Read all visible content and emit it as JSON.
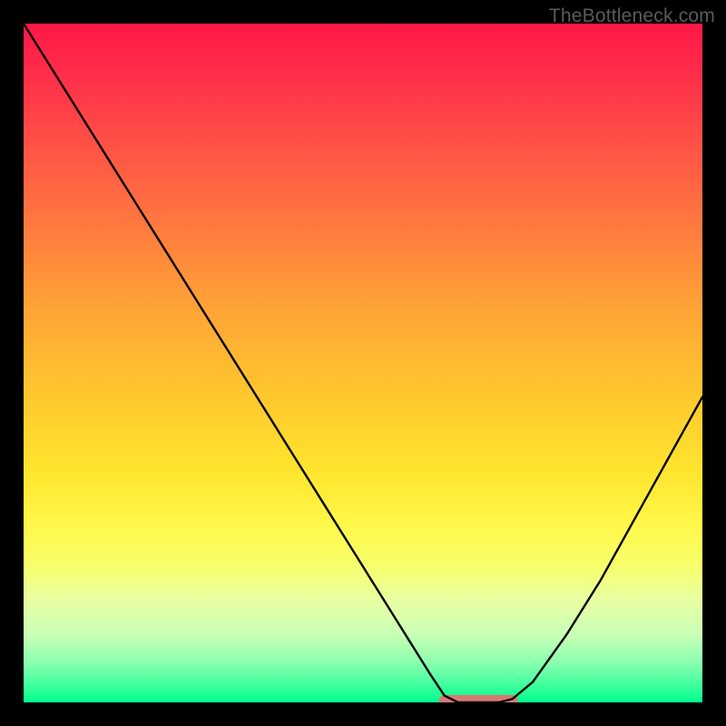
{
  "watermark": "TheBottleneck.com",
  "colors": {
    "frame": "#000000",
    "curve": "#000000",
    "highlight": "#d77a74"
  },
  "chart_data": {
    "type": "line",
    "title": "",
    "xlabel": "",
    "ylabel": "",
    "xlim": [
      0,
      100
    ],
    "ylim": [
      0,
      100
    ],
    "x": [
      0,
      5,
      10,
      15,
      20,
      25,
      30,
      35,
      40,
      45,
      50,
      55,
      60,
      62,
      64,
      66,
      68,
      70,
      72,
      75,
      80,
      85,
      90,
      95,
      100
    ],
    "y": [
      100,
      92,
      84,
      76,
      68,
      60,
      52,
      44,
      36,
      28,
      20,
      12,
      4,
      1,
      0,
      0,
      0,
      0,
      0.5,
      3,
      10,
      18,
      27,
      36,
      45
    ],
    "flat_region_x": [
      62,
      72
    ],
    "notes": "V-shaped bottleneck curve. Left arm descends nearly linearly from (0,100) to about (62,1). Bottom is flat at y≈0 between x≈62 and x≈72 — highlighted in a salmon/pink color. Right arm rises from (72,0.5) to roughly (100,45). Background is a vertical heat gradient from red (top=worst) to green (bottom=best)."
  }
}
